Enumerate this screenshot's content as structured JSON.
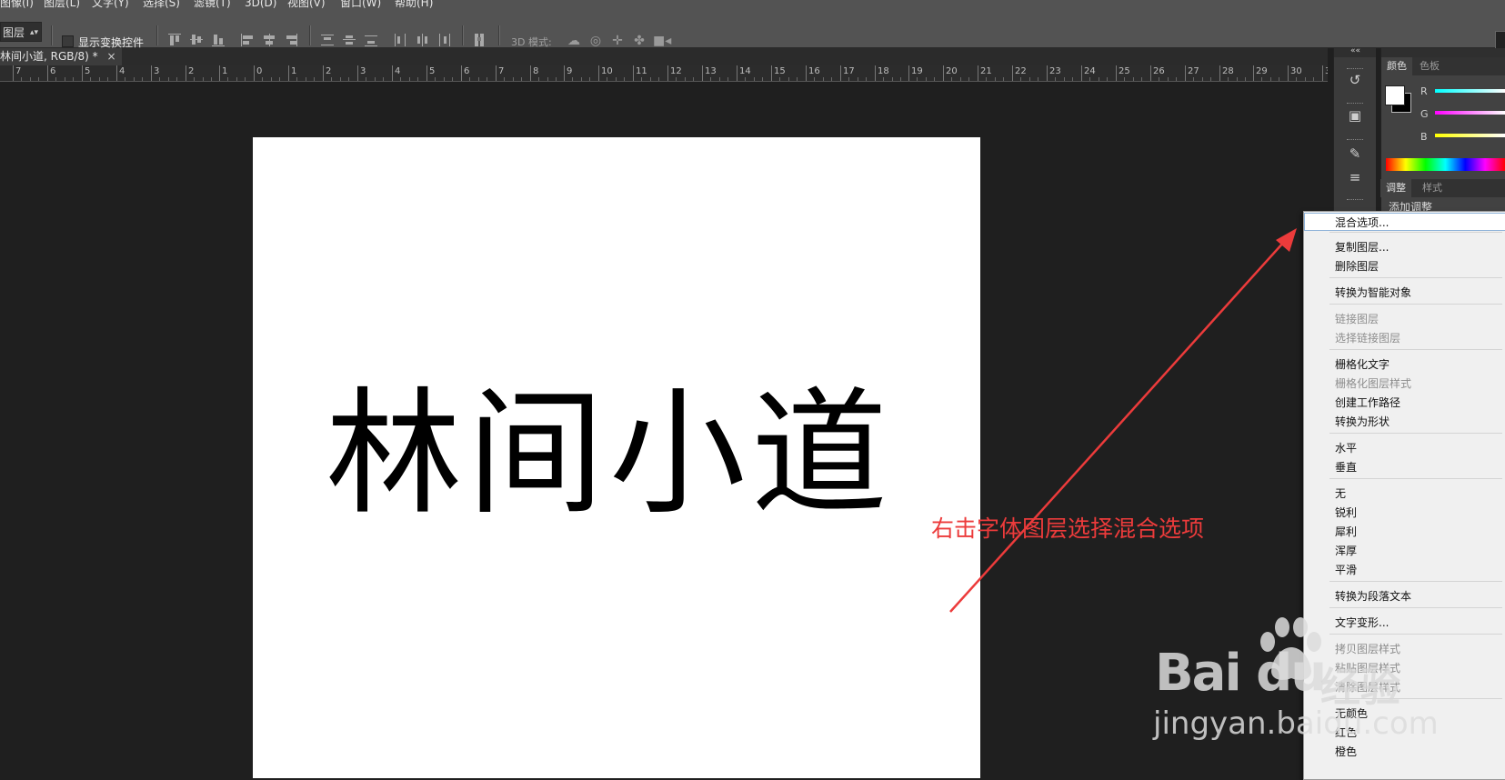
{
  "menubar": {
    "items": [
      "图像(I)",
      "图层(L)",
      "文字(Y)",
      "选择(S)",
      "滤镜(T)",
      "3D(D)",
      "视图(V)",
      "窗口(W)",
      "帮助(H)"
    ]
  },
  "options_bar": {
    "layer_select": "图层",
    "show_transform_label": "显示变换控件",
    "mode_3d_label": "3D 模式:"
  },
  "document": {
    "tab_title": "林间小道, RGB/8) *",
    "tab_close": "×",
    "canvas_text": "林间小道"
  },
  "ruler": {
    "labels": [
      "7",
      "6",
      "5",
      "4",
      "3",
      "2",
      "1",
      "0",
      "1",
      "2",
      "3",
      "4",
      "5",
      "6",
      "7",
      "8",
      "9",
      "10",
      "11",
      "12",
      "13",
      "14",
      "15",
      "16",
      "17",
      "18",
      "19",
      "20",
      "21",
      "22",
      "23",
      "24",
      "25",
      "26",
      "27",
      "28",
      "29",
      "30",
      "3"
    ]
  },
  "annotation": {
    "text": "右击字体图层选择混合选项",
    "color": "#ec3b3b"
  },
  "panels": {
    "collapse_glyph": "««",
    "color_tabs": [
      "颜色",
      "色板"
    ],
    "sliders": [
      "R",
      "G",
      "B"
    ],
    "adjust_tabs": [
      "调整",
      "样式"
    ],
    "add_adjustment": "添加调整"
  },
  "context_menu": {
    "items": [
      {
        "label": "混合选项...",
        "enabled": true,
        "highlighted": true
      },
      {
        "label": "复制图层...",
        "enabled": true
      },
      {
        "label": "删除图层",
        "enabled": true
      },
      {
        "label": "转换为智能对象",
        "enabled": true
      },
      {
        "label": "链接图层",
        "enabled": false
      },
      {
        "label": "选择链接图层",
        "enabled": false
      },
      {
        "label": "栅格化文字",
        "enabled": true
      },
      {
        "label": "栅格化图层样式",
        "enabled": false
      },
      {
        "label": "创建工作路径",
        "enabled": true
      },
      {
        "label": "转换为形状",
        "enabled": true
      },
      {
        "label": "水平",
        "enabled": true
      },
      {
        "label": "垂直",
        "enabled": true
      },
      {
        "label": "无",
        "enabled": true
      },
      {
        "label": "锐利",
        "enabled": true
      },
      {
        "label": "犀利",
        "enabled": true
      },
      {
        "label": "浑厚",
        "enabled": true
      },
      {
        "label": "平滑",
        "enabled": true
      },
      {
        "label": "转换为段落文本",
        "enabled": true
      },
      {
        "label": "文字变形...",
        "enabled": true
      },
      {
        "label": "拷贝图层样式",
        "enabled": false
      },
      {
        "label": "粘贴图层样式",
        "enabled": false
      },
      {
        "label": "清除图层样式",
        "enabled": false
      },
      {
        "label": "无颜色",
        "enabled": true
      },
      {
        "label": "红色",
        "enabled": true
      },
      {
        "label": "橙色",
        "enabled": true
      }
    ]
  },
  "watermark": {
    "brand": "Bai du",
    "product": "经验",
    "url": "jingyan.baidu.com"
  },
  "colors": {
    "app_bg": "#1f1f1f",
    "toolbar_bg": "#535353",
    "canvas": "#ffffff",
    "annotation_red": "#ec3b3b"
  }
}
